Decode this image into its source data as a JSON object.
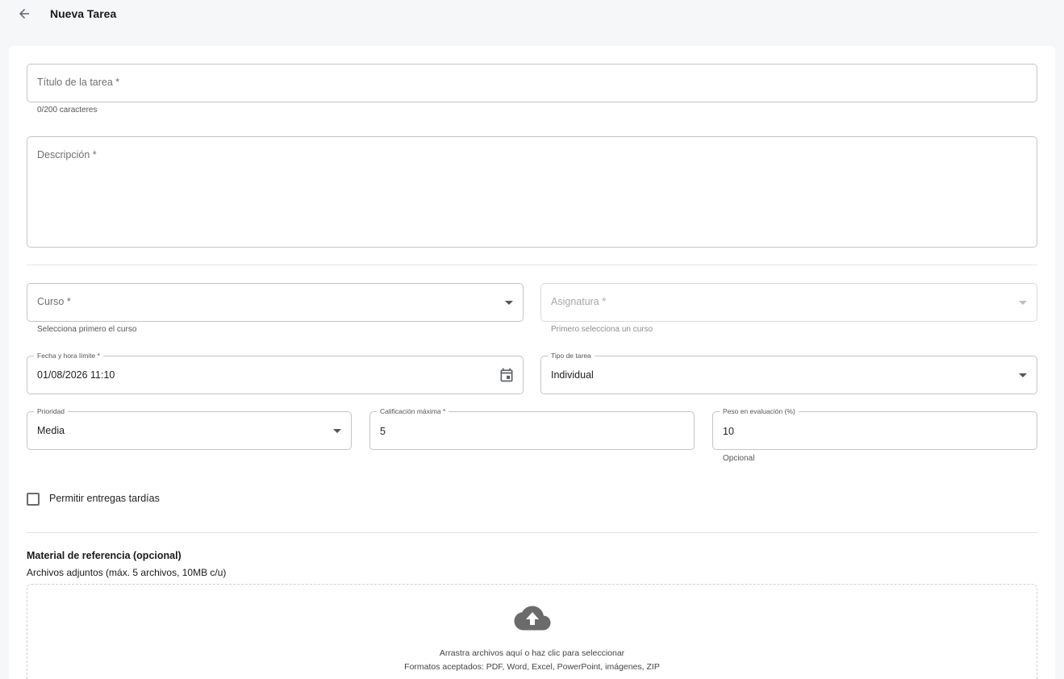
{
  "header": {
    "title": "Nueva Tarea",
    "back_icon": "arrow-left-icon"
  },
  "form": {
    "title_field": {
      "placeholder": "Título de la tarea *",
      "counter": "0/200 caracteres"
    },
    "description_field": {
      "placeholder": "Descripción *"
    },
    "course_field": {
      "placeholder": "Curso *",
      "helper": "Selecciona primero el curso"
    },
    "subject_field": {
      "placeholder": "Asignatura *",
      "helper": "Primero selecciona un curso"
    },
    "due_date_field": {
      "label": "Fecha y hora límite *",
      "value": "01/08/2026 11:10",
      "icon": "calendar-icon"
    },
    "task_type_field": {
      "label": "Tipo de tarea",
      "value": "Individual"
    },
    "priority_field": {
      "label": "Prioridad",
      "value": "Media"
    },
    "max_grade_field": {
      "label": "Calificación máxima *",
      "value": "5"
    },
    "weight_field": {
      "label": "Peso en evaluación (%)",
      "value": "10",
      "helper": "Opcional"
    },
    "late_submissions": {
      "label": "Permitir entregas tardías",
      "checked": false
    }
  },
  "attachments": {
    "title": "Material de referencia (opcional)",
    "subtitle": "Archivos adjuntos (máx. 5 archivos, 10MB c/u)",
    "drop_text": "Arrastra archivos aquí o haz clic para seleccionar",
    "formats_text": "Formatos aceptados: PDF, Word, Excel, PowerPoint, imágenes, ZIP",
    "icon": "cloud-upload-icon"
  }
}
